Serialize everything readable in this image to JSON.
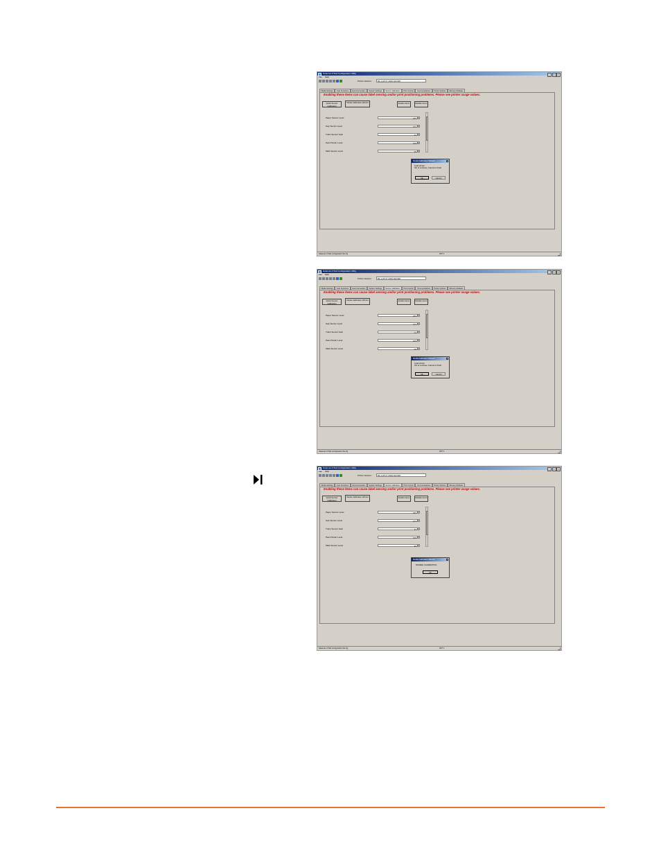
{
  "app": {
    "title": "Datamax-O'Neil Configuration Utility",
    "menu": [
      "File",
      "Help"
    ],
    "printer_fw_label": "Printer Version:",
    "printer_fw_value": "83-1-18 27 2010 A4CSIP",
    "tabs": [
      "Media Settings",
      "User Functions",
      "Host Connection",
      "System Settings",
      "Sensor Calibration",
      "Print Control",
      "Communications",
      "Printer Options",
      "Memory Modules"
    ],
    "warning": "Enabling these items can cause label sensing and/or print positioning problems. Please see printer usage values.",
    "buttons": {
      "quick_calibration": "Quick Sensor Calibration",
      "wizard": "Media Calibration Wizard",
      "enable_items": "Enable Items",
      "disable_items": "Disable Items"
    },
    "sensor_levels": [
      {
        "label": "Paper Sensor Level",
        "value": "221"
      },
      {
        "label": "Gap Sensor Level",
        "value": "171"
      },
      {
        "label": "Trans Sensor Gain",
        "value": "31"
      },
      {
        "label": "Peel Pointer Level",
        "value": "104"
      },
      {
        "label": "Mark Sensor Level",
        "value": "40"
      }
    ],
    "status_left": "Datamax-O'Neil configuration file.cfg",
    "status_right": "NPT 1"
  },
  "screens": [
    {
      "dialog_title": "Media Calibration Wizard",
      "message_1": "Load printer",
      "message_2": "OK to continue, Cancel to finish",
      "ok": "Ok",
      "cancel": "Cancel"
    },
    {
      "dialog_title": "Media Calibration Wizard",
      "message_1": "Load printer",
      "message_2": "OK to continue, Cancel to finish",
      "ok": "Ok",
      "cancel": "Cancel"
    },
    {
      "dialog_title": "Media Calibration Wizard",
      "message_1": "PASSED CALIBRATION",
      "ok": "Ok"
    }
  ]
}
